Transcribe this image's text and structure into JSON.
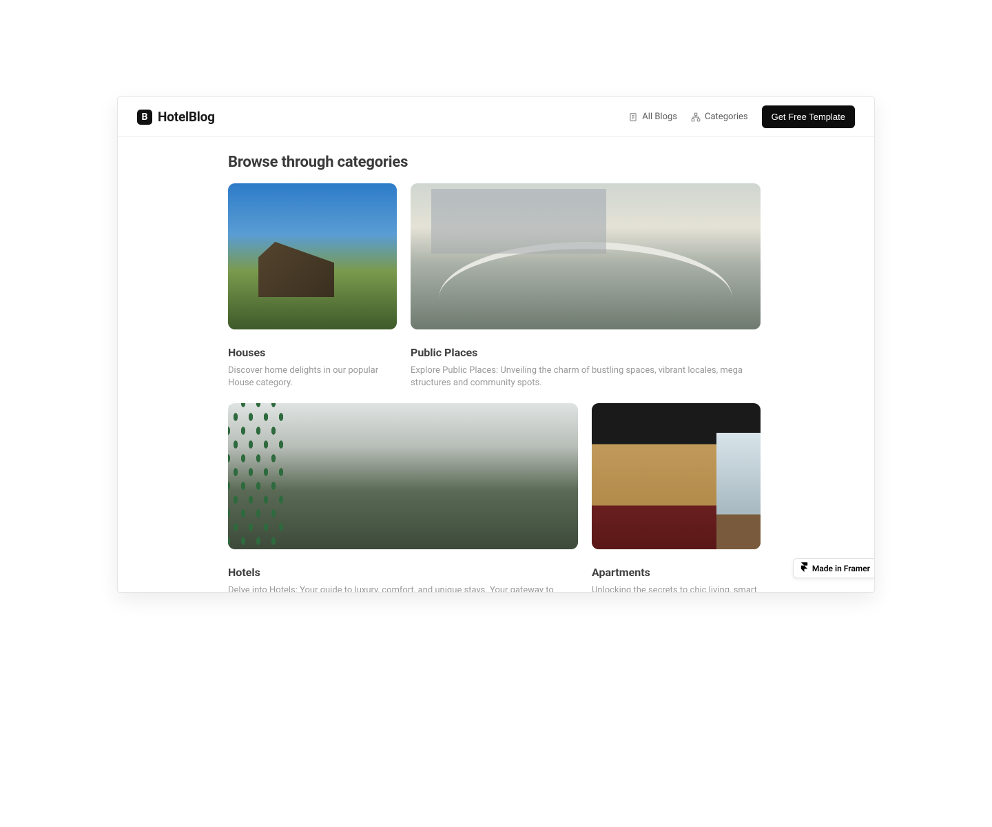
{
  "brand": {
    "logo_letter": "B",
    "name": "HotelBlog"
  },
  "nav": {
    "all_blogs": "All Blogs",
    "categories": "Categories",
    "cta": "Get Free Template"
  },
  "page": {
    "title": "Browse through categories"
  },
  "cards": {
    "houses": {
      "title": "Houses",
      "desc": "Discover home delights in our popular House category."
    },
    "public_places": {
      "title": "Public Places",
      "desc": "Explore Public Places: Unveiling the charm of bustling spaces, vibrant locales, mega structures and community spots."
    },
    "hotels": {
      "title": "Hotels",
      "desc": "Delve into Hotels: Your guide to luxury, comfort, and unique stays. Your gateway to luxury, comfort, and distinctive stays."
    },
    "apartments": {
      "title": "Apartments",
      "desc": "Unlocking the secrets to chic living, smart spaces, & lifestyles"
    }
  },
  "badge": {
    "label": "Made in Framer"
  }
}
